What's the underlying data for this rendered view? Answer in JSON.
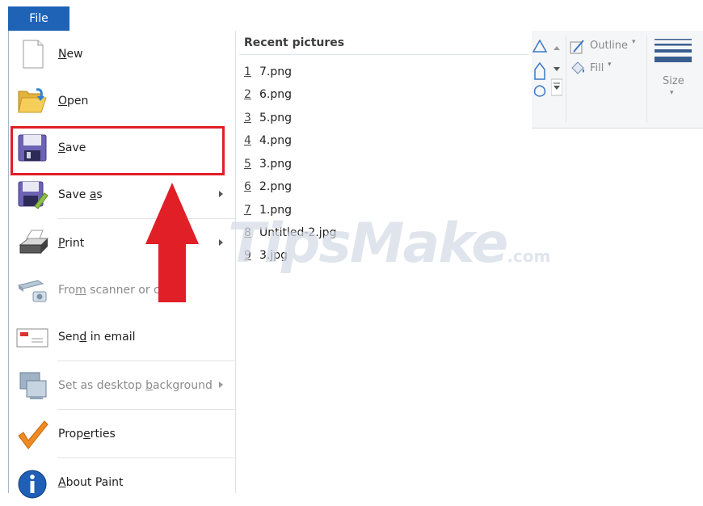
{
  "file_tab": "File",
  "ribbon": {
    "outline_label": "Outline",
    "fill_label": "Fill",
    "size_label": "Size"
  },
  "menu_items": [
    {
      "pre": "",
      "key": "N",
      "post": "ew",
      "icon": "new-document-icon"
    },
    {
      "pre": "",
      "key": "O",
      "post": "pen",
      "icon": "open-folder-icon"
    },
    {
      "pre": "",
      "key": "S",
      "post": "ave",
      "icon": "floppy-save-icon"
    },
    {
      "pre": "Save ",
      "key": "a",
      "post": "s",
      "icon": "save-as-icon",
      "submenu": true
    },
    {
      "pre": "",
      "key": "P",
      "post": "rint",
      "icon": "printer-icon",
      "submenu": true
    },
    {
      "pre": "Fro",
      "key": "m",
      "post": " scanner or ca",
      "icon": "scanner-camera-icon",
      "disabled": true
    },
    {
      "pre": "Sen",
      "key": "d",
      "post": " in email",
      "icon": "email-envelope-icon"
    },
    {
      "pre": "Set as desktop ",
      "key": "b",
      "post": "ackground",
      "icon": "desktop-background-icon",
      "submenu": true,
      "disabled": true
    },
    {
      "pre": "Prop",
      "key": "e",
      "post": "rties",
      "icon": "checkmark-icon"
    },
    {
      "pre": "",
      "key": "A",
      "post": "bout Paint",
      "icon": "info-icon"
    }
  ],
  "recent": {
    "title": "Recent pictures",
    "items": [
      {
        "num": "1",
        "name": "7.png"
      },
      {
        "num": "2",
        "name": "6.png"
      },
      {
        "num": "3",
        "name": "5.png"
      },
      {
        "num": "4",
        "name": "4.png"
      },
      {
        "num": "5",
        "name": "3.png"
      },
      {
        "num": "6",
        "name": "2.png"
      },
      {
        "num": "7",
        "name": "1.png"
      },
      {
        "num": "8",
        "name": "Untitled-2.jpg"
      },
      {
        "num": "9",
        "name": "3.jpg"
      }
    ]
  },
  "watermark": {
    "main": "TipsMake",
    "suffix": ".com"
  },
  "colors": {
    "file_tab": "#1f63b7",
    "highlight": "#e01f26",
    "arrow": "#e01f26"
  }
}
